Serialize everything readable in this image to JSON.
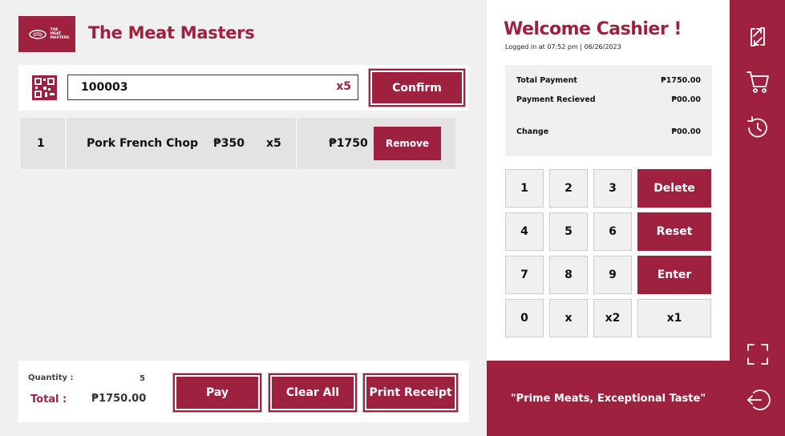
{
  "app": {
    "logo_text": "THE MEAT MASTERS",
    "title": "The Meat Masters"
  },
  "scan": {
    "icon": "qr-code-icon",
    "code_value": "100003",
    "multiplier": "x5",
    "confirm_label": "Confirm"
  },
  "items": [
    {
      "index": "1",
      "name": "Pork French Chop",
      "unit_price": "₱350",
      "qty": "x5",
      "total": "₱1750",
      "remove_label": "Remove"
    }
  ],
  "footer": {
    "quantity_label": "Quantity :",
    "quantity_value": "5",
    "total_label": "Total :",
    "total_value": "₱1750.00",
    "pay_label": "Pay",
    "clear_label": "Clear All",
    "print_label": "Print Receipt"
  },
  "session": {
    "welcome": "Welcome Cashier !",
    "logged_in": "Logged in at 07:52 pm | 06/26/2023"
  },
  "summary": {
    "total_payment_label": "Total Payment",
    "total_payment_value": "₱1750.00",
    "payment_received_label": "Payment Recieved",
    "payment_received_value": "₱00.00",
    "change_label": "Change",
    "change_value": "₱00.00"
  },
  "keypad": {
    "k1": "1",
    "k2": "2",
    "k3": "3",
    "delete": "Delete",
    "k4": "4",
    "k5": "5",
    "k6": "6",
    "reset": "Reset",
    "k7": "7",
    "k8": "8",
    "k9": "9",
    "enter": "Enter",
    "k0": "0",
    "kx": "x",
    "kx2": "x2",
    "kx1": "x1"
  },
  "tagline": "\"Prime Meats, Exceptional Taste\"",
  "sidebar_icons": [
    "swap-icon",
    "cart-icon",
    "history-icon",
    "fullscreen-icon",
    "logout-icon"
  ],
  "colors": {
    "accent": "#9f2140",
    "background": "#f0f0f0"
  }
}
